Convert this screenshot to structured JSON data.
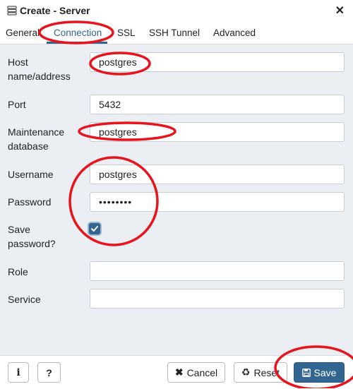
{
  "window": {
    "title": "Create - Server"
  },
  "tabs": [
    {
      "label": "General"
    },
    {
      "label": "Connection"
    },
    {
      "label": "SSL"
    },
    {
      "label": "SSH Tunnel"
    },
    {
      "label": "Advanced"
    }
  ],
  "active_tab": "Connection",
  "form": {
    "host": {
      "label_line1": "Host",
      "label_line2": "name/address",
      "value": "postgres"
    },
    "port": {
      "label": "Port",
      "value": "5432"
    },
    "maintenance": {
      "label_line1": "Maintenance",
      "label_line2": "database",
      "value": "postgres"
    },
    "username": {
      "label": "Username",
      "value": "postgres"
    },
    "password": {
      "label": "Password",
      "value": "••••••••"
    },
    "save_password": {
      "label_line1": "Save",
      "label_line2": "password?",
      "checked": true
    },
    "role": {
      "label": "Role",
      "value": ""
    },
    "service": {
      "label": "Service",
      "value": ""
    }
  },
  "footer": {
    "info_label": "i",
    "help_label": "?",
    "cancel_label": "Cancel",
    "reset_label": "Reset",
    "save_label": "Save"
  },
  "colors": {
    "accent": "#326690",
    "annotation": "#e8141b",
    "panel": "#ebeef3"
  }
}
